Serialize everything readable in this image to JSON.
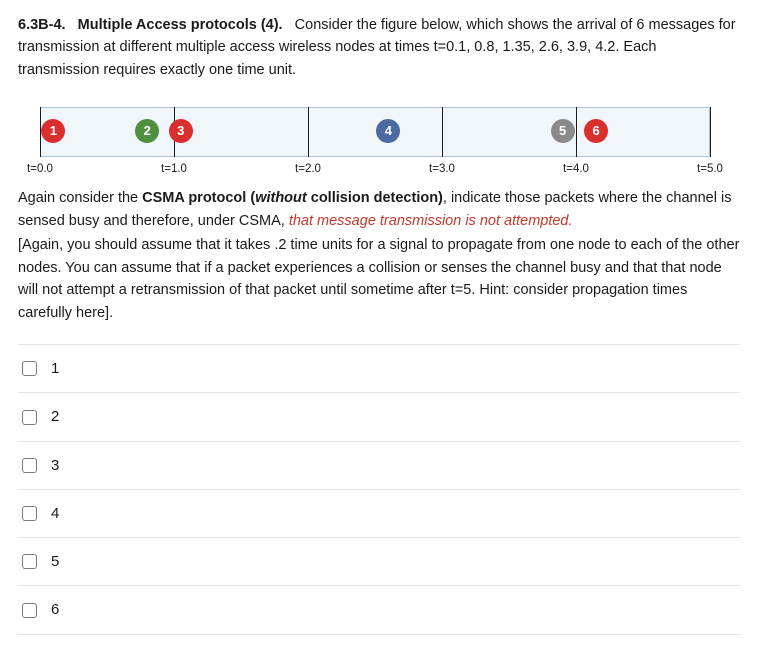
{
  "question": {
    "number": "6.3B-4.",
    "title": "Multiple Access protocols (4).",
    "intro": "Consider the figure below, which shows the arrival of 6 messages for transmission at different multiple access wireless nodes at times  t=0.1, 0.8, 1.35, 2.6, 3.9, 4.2. Each transmission requires exactly one time unit."
  },
  "timeline": {
    "ticks": [
      {
        "t": 0.0,
        "label": "t=0.0"
      },
      {
        "t": 1.0,
        "label": "t=1.0"
      },
      {
        "t": 2.0,
        "label": "t=2.0"
      },
      {
        "t": 3.0,
        "label": "t=3.0"
      },
      {
        "t": 4.0,
        "label": "t=4.0"
      },
      {
        "t": 5.0,
        "label": "t=5.0"
      }
    ],
    "arrivals": [
      {
        "id": "1",
        "t": 0.1,
        "color": "red"
      },
      {
        "id": "2",
        "t": 0.8,
        "color": "green"
      },
      {
        "id": "3",
        "t": 1.05,
        "color": "red"
      },
      {
        "id": "4",
        "t": 2.6,
        "color": "blue"
      },
      {
        "id": "5",
        "t": 3.9,
        "color": "grey"
      },
      {
        "id": "6",
        "t": 4.15,
        "color": "red"
      }
    ]
  },
  "prompt": {
    "line1_a": "Again consider the ",
    "line1_b": "CSMA protocol (",
    "line1_c": "without",
    "line1_d": " collision detection)",
    "line1_e": ", indicate those packets where the channel is sensed busy and therefore, under CSMA, ",
    "line1_red": "that message transmission is not attempted.",
    "line2": "[Again, you should assume that it takes .2 time units for a signal to propagate from one node to each of the other nodes. You can assume that if a packet experiences a collision or senses the channel busy and that that node will not attempt a retransmission of that packet until sometime after t=5. Hint: consider propagation times carefully here]."
  },
  "options": [
    {
      "label": "1"
    },
    {
      "label": "2"
    },
    {
      "label": "3"
    },
    {
      "label": "4"
    },
    {
      "label": "5"
    },
    {
      "label": "6"
    }
  ]
}
